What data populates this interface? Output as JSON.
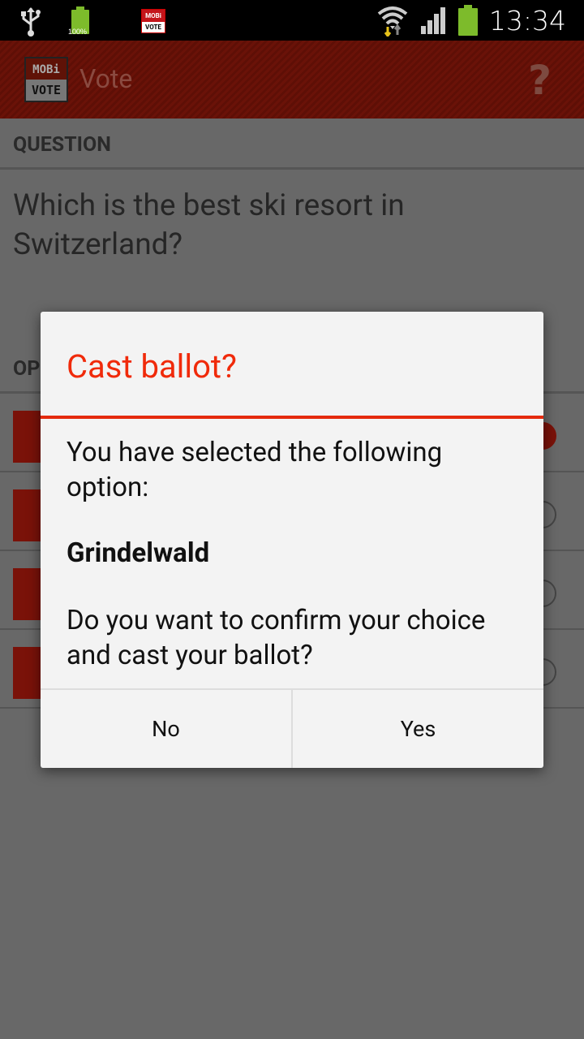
{
  "status_bar": {
    "battery_small_percent": "100%",
    "notification_app_top": "MOBi",
    "notification_app_bottom": "VOTE",
    "time": "13:34",
    "icons": [
      "usb-icon",
      "battery-icon",
      "mobivote-notification-icon",
      "wifi-icon",
      "signal-icon",
      "battery-icon"
    ]
  },
  "action_bar": {
    "logo_top": "MOBi",
    "logo_bottom": "VOTE",
    "title": "Vote",
    "help_label": "?"
  },
  "page": {
    "question_label": "QUESTION",
    "question_text": "Which is the best ski resort in Switzerland?",
    "options_label": "OP",
    "option_count": 4,
    "selected_option_index": 0
  },
  "dialog": {
    "title": "Cast ballot?",
    "message_intro": "You have selected the following option:",
    "selected_option": "Grindelwald",
    "message_confirm": "Do you want to confirm your choice and cast your ballot?",
    "no_label": "No",
    "yes_label": "Yes"
  },
  "colors": {
    "accent": "#f02a0a",
    "brand_red": "#c4151b",
    "battery_green": "#7dbb2b"
  }
}
